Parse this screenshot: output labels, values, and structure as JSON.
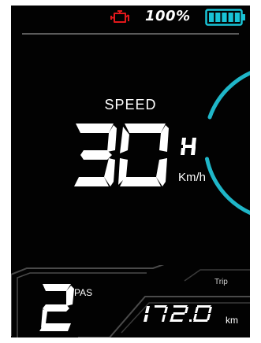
{
  "status_bar": {
    "engine_icon": "engine-warning-icon",
    "engine_color": "#e2181b",
    "battery_percent": "100%",
    "battery_icon": "battery-full-icon",
    "battery_color": "#19c3d6",
    "battery_level": 1.0
  },
  "speed": {
    "label": "SPEED",
    "value": "30",
    "unit": "Km/h",
    "ring_color": "#1fb6c8"
  },
  "pas": {
    "label": "PAS",
    "level": "2"
  },
  "trip": {
    "label": "Trip",
    "value": "172.0",
    "unit": "km"
  }
}
